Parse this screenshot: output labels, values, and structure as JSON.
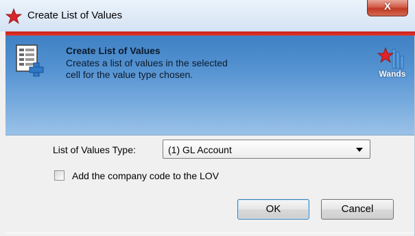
{
  "window": {
    "title": "Create List of Values",
    "close_label": "X",
    "app_icon": "red-star-icon"
  },
  "header": {
    "title": "Create List of Values",
    "description": "Creates a list of values in the selected cell for the value type chosen.",
    "icon": "document-plus-icon",
    "brand_logo_text": "Wands",
    "colors": {
      "header_top": "#3f81c4",
      "header_bottom": "#9bc2e8",
      "accent_red": "#d42a22"
    }
  },
  "form": {
    "lov_type_label": "List of Values Type:",
    "lov_type_value": "(1) GL Account",
    "company_code_label": "Add the company code to the LOV",
    "company_code_checked": false
  },
  "buttons": {
    "ok_label": "OK",
    "cancel_label": "Cancel"
  }
}
